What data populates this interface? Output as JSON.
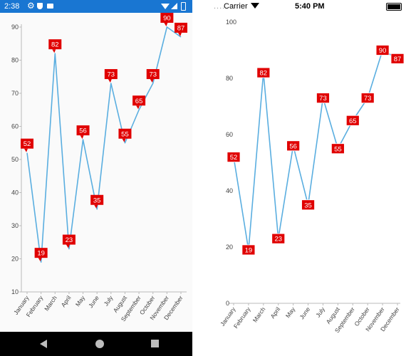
{
  "android": {
    "status": {
      "time": "2:38",
      "icons": [
        "gear-icon",
        "shield-icon",
        "mail-icon",
        "wifi-icon",
        "signal-icon",
        "battery-icon"
      ]
    },
    "nav_icons": [
      "back-icon",
      "home-icon",
      "recents-icon"
    ]
  },
  "ios": {
    "status": {
      "dots": "....",
      "carrier": "Carrier",
      "time": "5:40 PM",
      "icons": [
        "wifi-icon",
        "battery-icon"
      ]
    }
  },
  "colors": {
    "line": "#5aaee0",
    "label_bg": "#e00000",
    "label_text": "#ffffff",
    "axis_text": "#444444",
    "android_status_bg": "#1976d2"
  },
  "chart_data": [
    {
      "type": "line",
      "platform": "android",
      "categories": [
        "January",
        "February",
        "March",
        "April",
        "May",
        "June",
        "July",
        "August",
        "September",
        "October",
        "November",
        "December"
      ],
      "values": [
        52,
        19,
        82,
        23,
        56,
        35,
        73,
        55,
        65,
        73,
        90,
        87
      ],
      "y_ticks": [
        10,
        20,
        30,
        40,
        50,
        60,
        70,
        80,
        90
      ],
      "ylim": [
        10,
        90
      ],
      "data_labels": true,
      "label_style": "callout",
      "grid": false
    },
    {
      "type": "line",
      "platform": "ios",
      "categories": [
        "January",
        "February",
        "March",
        "April",
        "May",
        "June",
        "July",
        "August",
        "September",
        "October",
        "November",
        "December"
      ],
      "values": [
        52,
        19,
        82,
        23,
        56,
        35,
        73,
        55,
        65,
        73,
        90,
        87
      ],
      "y_ticks": [
        0,
        20,
        40,
        60,
        80,
        100
      ],
      "ylim": [
        0,
        100
      ],
      "data_labels": true,
      "label_style": "box",
      "grid": false
    }
  ]
}
